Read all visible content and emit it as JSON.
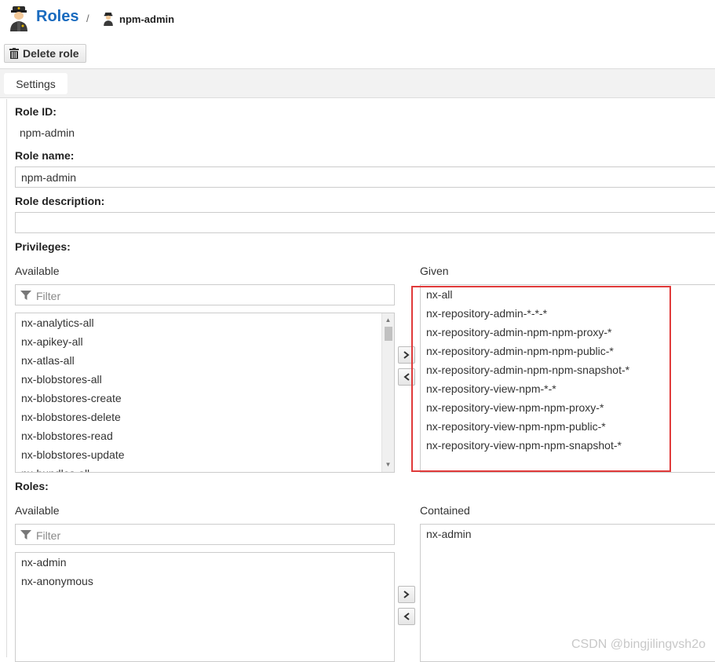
{
  "header": {
    "title": "Roles",
    "separator": "/",
    "breadcrumb": "npm-admin"
  },
  "toolbar": {
    "delete_label": "Delete role"
  },
  "tabs": [
    {
      "label": "Settings"
    }
  ],
  "form": {
    "role_id_label": "Role ID:",
    "role_id_value": "npm-admin",
    "role_name_label": "Role name:",
    "role_name_value": "npm-admin",
    "role_description_label": "Role description:",
    "role_description_value": ""
  },
  "privileges": {
    "label": "Privileges:",
    "available_label": "Available",
    "given_label": "Given",
    "filter_placeholder": "Filter",
    "available": [
      "nx-analytics-all",
      "nx-apikey-all",
      "nx-atlas-all",
      "nx-blobstores-all",
      "nx-blobstores-create",
      "nx-blobstores-delete",
      "nx-blobstores-read",
      "nx-blobstores-update",
      "nx-bundles-all"
    ],
    "given": [
      "nx-all",
      "nx-repository-admin-*-*-*",
      "nx-repository-admin-npm-npm-proxy-*",
      "nx-repository-admin-npm-npm-public-*",
      "nx-repository-admin-npm-npm-snapshot-*",
      "nx-repository-view-npm-*-*",
      "nx-repository-view-npm-npm-proxy-*",
      "nx-repository-view-npm-npm-public-*",
      "nx-repository-view-npm-npm-snapshot-*"
    ]
  },
  "roles": {
    "label": "Roles:",
    "available_label": "Available",
    "contained_label": "Contained",
    "filter_placeholder": "Filter",
    "available": [
      "nx-admin",
      "nx-anonymous"
    ],
    "contained": [
      "nx-admin"
    ]
  },
  "icons": {
    "role": "police-officer-icon",
    "delete": "trash-icon",
    "filter": "funnel-icon",
    "add": "chevron-right-icon",
    "remove": "chevron-left-icon"
  },
  "colors": {
    "title": "#1a6bbf",
    "highlight": "#e03a3a"
  },
  "watermark": "CSDN @bingjilingvsh2o"
}
